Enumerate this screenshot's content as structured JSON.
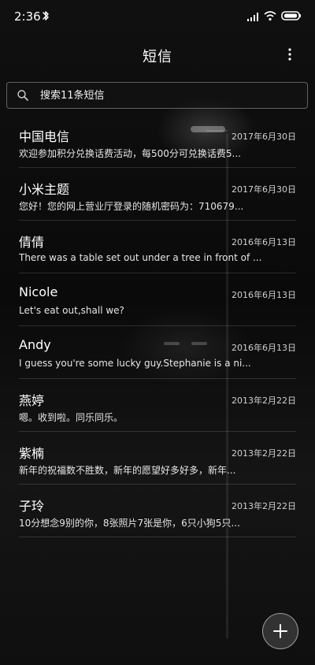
{
  "status_bar": {
    "time": "2:36",
    "icons": [
      "bluetooth-icon",
      "signal-icon",
      "wifi-icon",
      "battery-icon"
    ]
  },
  "header": {
    "title": "短信",
    "menu_icon": "more-vertical-icon"
  },
  "search": {
    "placeholder": "搜索11条短信",
    "icon": "search-icon"
  },
  "messages": [
    {
      "name": "中国电信",
      "date": "2017年6月30日",
      "preview": "欢迎参加积分兑换话费活动，每500分可兑换话费5..."
    },
    {
      "name": "小米主题",
      "date": "2017年6月30日",
      "preview": "您好！您的网上营业厅登录的随机密码为：710679..."
    },
    {
      "name": "倩倩",
      "date": "2016年6月13日",
      "preview": "There was a table set out under a tree in front of ..."
    },
    {
      "name": "Nicole",
      "date": "2016年6月13日",
      "preview": "Let's eat out,shall we?"
    },
    {
      "name": "Andy",
      "date": "2016年6月13日",
      "preview": "I guess you're some lucky guy.Stephanie is a ni..."
    },
    {
      "name": "燕婷",
      "date": "2013年2月22日",
      "preview": "嗯。收到啦。同乐同乐。"
    },
    {
      "name": "紫楠",
      "date": "2013年2月22日",
      "preview": "新年的祝福数不胜数，新年的愿望好多好多，新年..."
    },
    {
      "name": "子玲",
      "date": "2013年2月22日",
      "preview": "10分想念9别的你，8张照片7张是你，6只小狗5只..."
    }
  ],
  "fab": {
    "icon": "plus-icon"
  },
  "colors": {
    "background": "#0b0b0b",
    "text": "#f2f2f2",
    "divider": "#242424"
  }
}
